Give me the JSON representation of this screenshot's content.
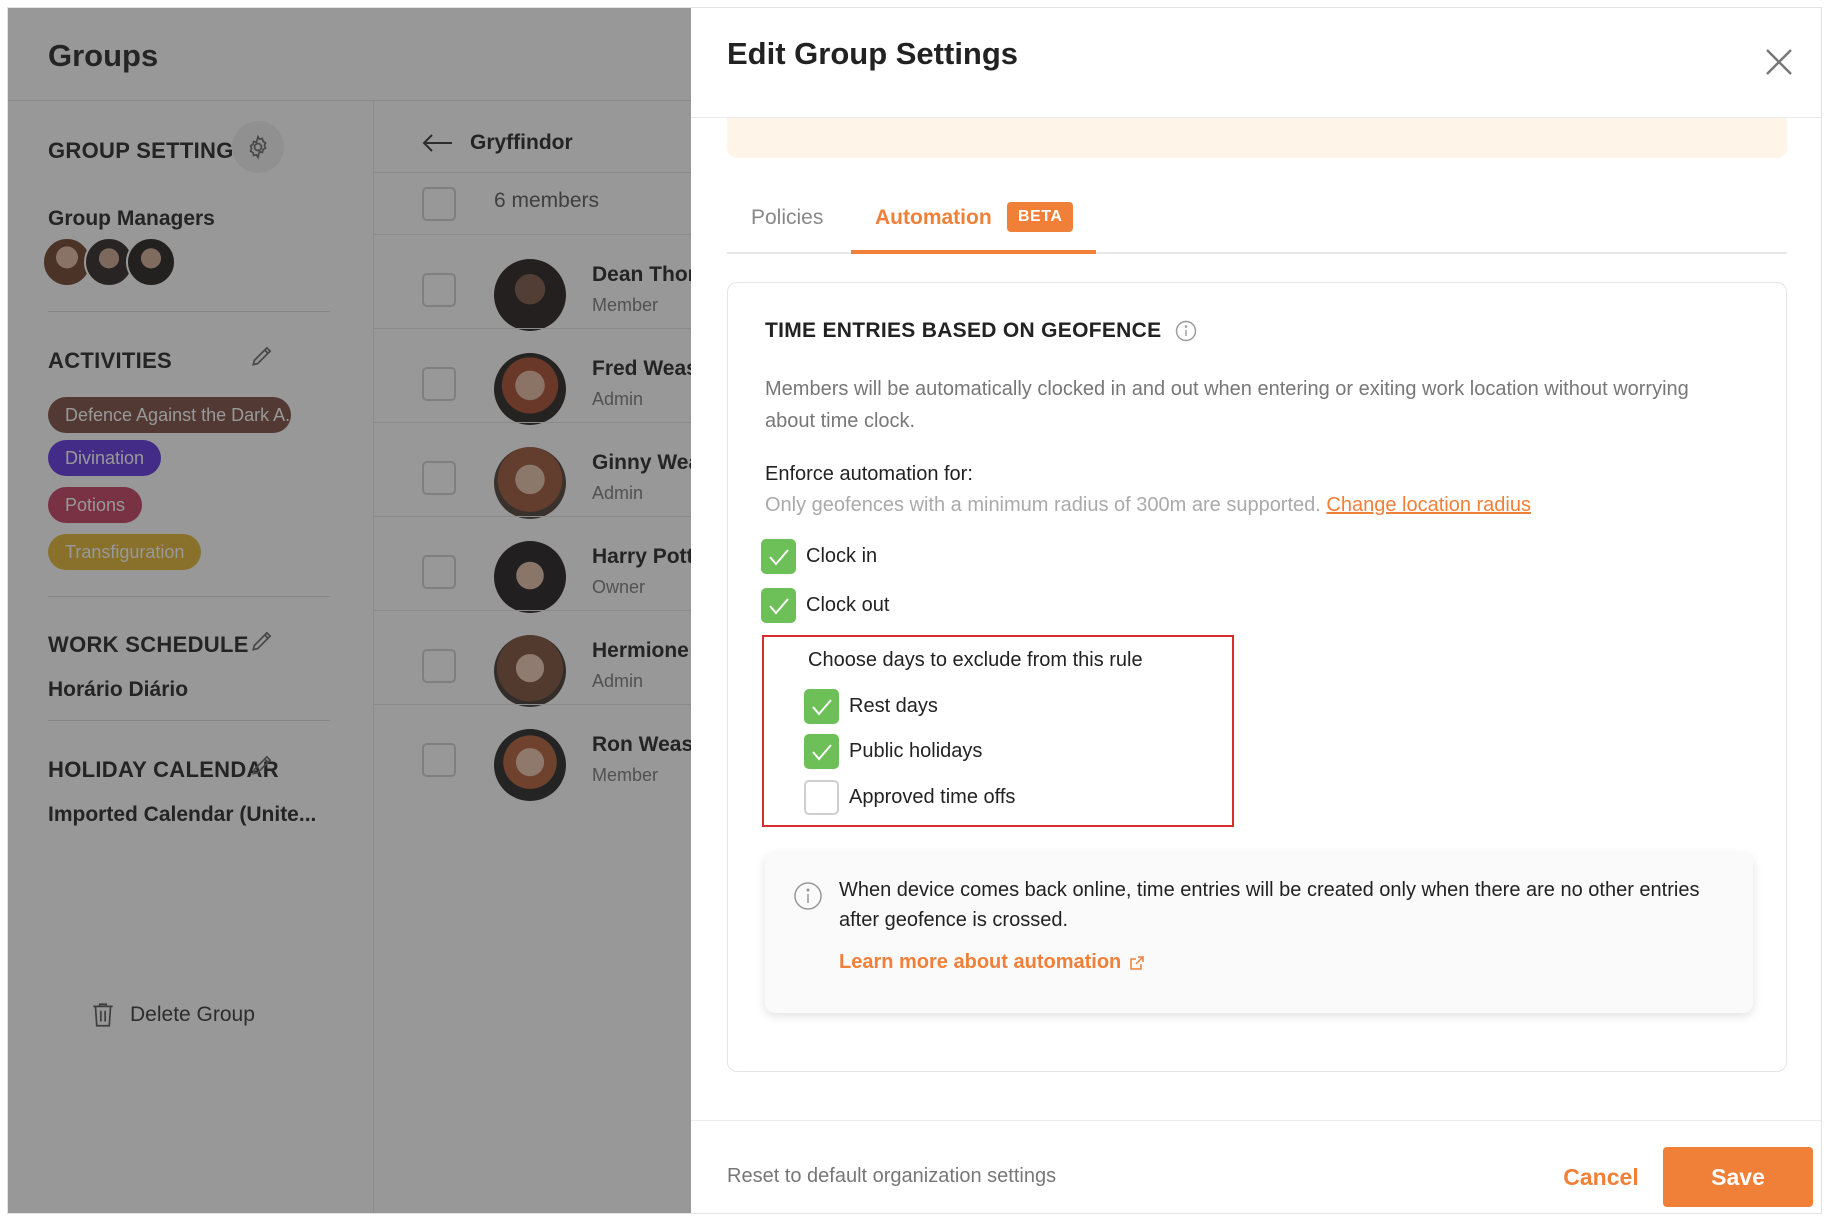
{
  "app": {
    "title": "Groups"
  },
  "left_panel": {
    "group_settings": {
      "title": "GROUP SETTINGS",
      "icon": "gear-icon"
    },
    "group_managers": {
      "title": "Group Managers",
      "count": 3
    },
    "activities": {
      "title": "ACTIVITIES",
      "icon": "pencil-icon",
      "items": [
        {
          "label": "Defence Against the Dark A...",
          "color": "#7a4a3e"
        },
        {
          "label": "Divination",
          "color": "#5b30e0"
        },
        {
          "label": "Potions",
          "color": "#c43a5e"
        },
        {
          "label": "Transfiguration",
          "color": "#e3b52e"
        }
      ]
    },
    "work_schedule": {
      "title": "WORK SCHEDULE",
      "value": "Horário Diário",
      "icon": "pencil-icon"
    },
    "holiday_calendar": {
      "title": "HOLIDAY CALENDAR",
      "value": "Imported Calendar (Unite...",
      "icon": "pencil-icon"
    },
    "delete_group": {
      "label": "Delete Group",
      "icon": "trash-icon"
    }
  },
  "members_panel": {
    "group_name": "Gryffindor",
    "members_count": "6 members",
    "members": [
      {
        "name": "Dean Thor",
        "role": "Member"
      },
      {
        "name": "Fred Weas",
        "role": "Admin"
      },
      {
        "name": "Ginny Wea",
        "role": "Admin"
      },
      {
        "name": "Harry Pott",
        "role": "Owner"
      },
      {
        "name": "Hermione",
        "role": "Admin"
      },
      {
        "name": "Ron Weasl",
        "role": "Member"
      }
    ]
  },
  "drawer": {
    "title": "Edit Group Settings",
    "tabs": {
      "policies": "Policies",
      "automation": "Automation",
      "beta_badge": "BETA",
      "active": "automation"
    },
    "geofence": {
      "title": "TIME ENTRIES BASED ON GEOFENCE",
      "description": "Members will be automatically clocked in and out when entering or exiting work location without worrying about time clock.",
      "enforce_label": "Enforce automation for:",
      "radius_note": "Only geofences with a minimum radius of 300m are supported.",
      "radius_link": "Change location radius",
      "clock_in": {
        "label": "Clock in",
        "checked": true
      },
      "clock_out": {
        "label": "Clock out",
        "checked": true
      },
      "exclude": {
        "title": "Choose days to exclude from this rule",
        "rest_days": {
          "label": "Rest days",
          "checked": true
        },
        "public_holidays": {
          "label": "Public holidays",
          "checked": true
        },
        "approved_time_offs": {
          "label": "Approved time offs",
          "checked": false
        }
      },
      "info_text": "When device comes back online, time entries will be created only when there are no other entries after geofence is crossed.",
      "learn_more": "Learn more about automation"
    },
    "footer": {
      "reset": "Reset to default organization settings",
      "cancel": "Cancel",
      "save": "Save"
    }
  },
  "colors": {
    "accent": "#f07f38",
    "check": "#6cc057",
    "highlight_border": "#d92c2c"
  }
}
